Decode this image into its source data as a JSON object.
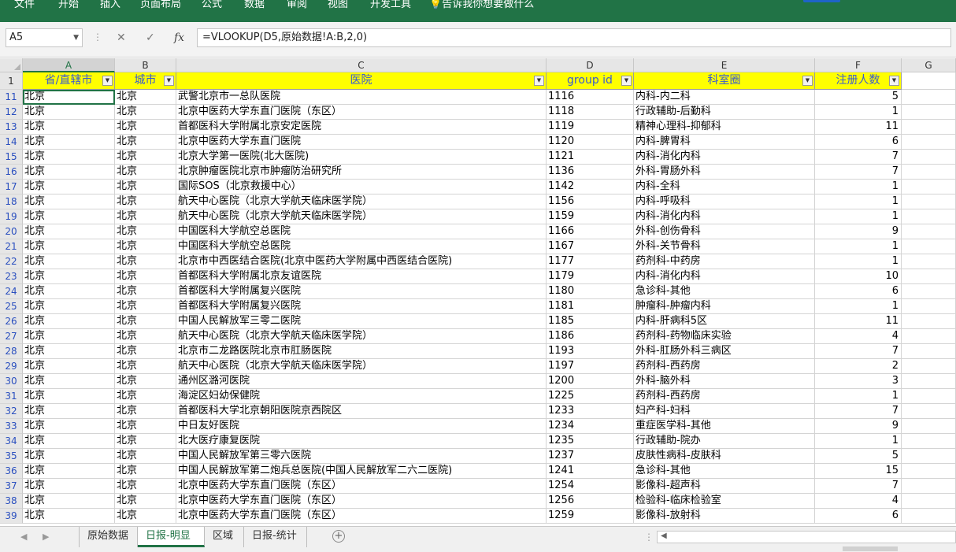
{
  "ribbon": {
    "tabs": [
      "文件",
      "开始",
      "插入",
      "页面布局",
      "公式",
      "数据",
      "审阅",
      "视图",
      "开发工具"
    ],
    "tell_me": "告诉我你想要做什么"
  },
  "formula_bar": {
    "name_box": "A5",
    "formula": "=VLOOKUP(D5,原始数据!A:B,2,0)"
  },
  "columns": [
    "A",
    "B",
    "C",
    "D",
    "E",
    "F",
    "G"
  ],
  "header_row": {
    "row_number": "1",
    "cells": [
      "省/直辖市",
      "城市",
      "医院",
      "group id",
      "科室圈",
      "注册人数"
    ]
  },
  "rows": [
    {
      "n": "11",
      "a": "北京",
      "b": "北京",
      "c": "武警北京市一总队医院",
      "d": "1116",
      "e": "内科-内二科",
      "f": "5"
    },
    {
      "n": "12",
      "a": "北京",
      "b": "北京",
      "c": "北京中医药大学东直门医院（东区）",
      "d": "1118",
      "e": "行政辅助-后勤科",
      "f": "1"
    },
    {
      "n": "13",
      "a": "北京",
      "b": "北京",
      "c": "首都医科大学附属北京安定医院",
      "d": "1119",
      "e": "精神心理科-抑郁科",
      "f": "11"
    },
    {
      "n": "14",
      "a": "北京",
      "b": "北京",
      "c": "北京中医药大学东直门医院",
      "d": "1120",
      "e": "内科-脾胃科",
      "f": "6"
    },
    {
      "n": "15",
      "a": "北京",
      "b": "北京",
      "c": "北京大学第一医院(北大医院)",
      "d": "1121",
      "e": "内科-消化内科",
      "f": "7"
    },
    {
      "n": "16",
      "a": "北京",
      "b": "北京",
      "c": "北京肿瘤医院北京市肿瘤防治研究所",
      "d": "1136",
      "e": "外科-胃肠外科",
      "f": "7"
    },
    {
      "n": "17",
      "a": "北京",
      "b": "北京",
      "c": "国际SOS（北京救援中心）",
      "d": "1142",
      "e": "内科-全科",
      "f": "1"
    },
    {
      "n": "18",
      "a": "北京",
      "b": "北京",
      "c": "航天中心医院（北京大学航天临床医学院）",
      "d": "1156",
      "e": "内科-呼吸科",
      "f": "1"
    },
    {
      "n": "19",
      "a": "北京",
      "b": "北京",
      "c": "航天中心医院（北京大学航天临床医学院）",
      "d": "1159",
      "e": "内科-消化内科",
      "f": "1"
    },
    {
      "n": "20",
      "a": "北京",
      "b": "北京",
      "c": "中国医科大学航空总医院",
      "d": "1166",
      "e": "外科-创伤骨科",
      "f": "9"
    },
    {
      "n": "21",
      "a": "北京",
      "b": "北京",
      "c": "中国医科大学航空总医院",
      "d": "1167",
      "e": "外科-关节骨科",
      "f": "1"
    },
    {
      "n": "22",
      "a": "北京",
      "b": "北京",
      "c": "北京市中西医结合医院(北京中医药大学附属中西医结合医院)",
      "d": "1177",
      "e": "药剂科-中药房",
      "f": "1"
    },
    {
      "n": "23",
      "a": "北京",
      "b": "北京",
      "c": "首都医科大学附属北京友谊医院",
      "d": "1179",
      "e": "内科-消化内科",
      "f": "10"
    },
    {
      "n": "24",
      "a": "北京",
      "b": "北京",
      "c": "首都医科大学附属复兴医院",
      "d": "1180",
      "e": "急诊科-其他",
      "f": "6"
    },
    {
      "n": "25",
      "a": "北京",
      "b": "北京",
      "c": "首都医科大学附属复兴医院",
      "d": "1181",
      "e": "肿瘤科-肿瘤内科",
      "f": "1"
    },
    {
      "n": "26",
      "a": "北京",
      "b": "北京",
      "c": "中国人民解放军三零二医院",
      "d": "1185",
      "e": "内科-肝病科5区",
      "f": "11"
    },
    {
      "n": "27",
      "a": "北京",
      "b": "北京",
      "c": "航天中心医院（北京大学航天临床医学院）",
      "d": "1186",
      "e": "药剂科-药物临床实验",
      "f": "4"
    },
    {
      "n": "28",
      "a": "北京",
      "b": "北京",
      "c": "北京市二龙路医院北京市肛肠医院",
      "d": "1193",
      "e": "外科-肛肠外科三病区",
      "f": "7"
    },
    {
      "n": "29",
      "a": "北京",
      "b": "北京",
      "c": "航天中心医院（北京大学航天临床医学院）",
      "d": "1197",
      "e": "药剂科-西药房",
      "f": "2"
    },
    {
      "n": "30",
      "a": "北京",
      "b": "北京",
      "c": "通州区潞河医院",
      "d": "1200",
      "e": "外科-脑外科",
      "f": "3"
    },
    {
      "n": "31",
      "a": "北京",
      "b": "北京",
      "c": "海淀区妇幼保健院",
      "d": "1225",
      "e": "药剂科-西药房",
      "f": "1"
    },
    {
      "n": "32",
      "a": "北京",
      "b": "北京",
      "c": "首都医科大学北京朝阳医院京西院区",
      "d": "1233",
      "e": "妇产科-妇科",
      "f": "7"
    },
    {
      "n": "33",
      "a": "北京",
      "b": "北京",
      "c": "中日友好医院",
      "d": "1234",
      "e": "重症医学科-其他",
      "f": "9"
    },
    {
      "n": "34",
      "a": "北京",
      "b": "北京",
      "c": "北大医疗康复医院",
      "d": "1235",
      "e": "行政辅助-院办",
      "f": "1"
    },
    {
      "n": "35",
      "a": "北京",
      "b": "北京",
      "c": "中国人民解放军第三零六医院",
      "d": "1237",
      "e": "皮肤性病科-皮肤科",
      "f": "5"
    },
    {
      "n": "36",
      "a": "北京",
      "b": "北京",
      "c": "中国人民解放军第二炮兵总医院(中国人民解放军二六二医院)",
      "d": "1241",
      "e": "急诊科-其他",
      "f": "15"
    },
    {
      "n": "37",
      "a": "北京",
      "b": "北京",
      "c": "北京中医药大学东直门医院（东区）",
      "d": "1254",
      "e": "影像科-超声科",
      "f": "7"
    },
    {
      "n": "38",
      "a": "北京",
      "b": "北京",
      "c": "北京中医药大学东直门医院（东区）",
      "d": "1256",
      "e": "检验科-临床检验室",
      "f": "4"
    },
    {
      "n": "39",
      "a": "北京",
      "b": "北京",
      "c": "北京中医药大学东直门医院（东区）",
      "d": "1259",
      "e": "影像科-放射科",
      "f": "6"
    }
  ],
  "sheet_tabs": [
    "原始数据",
    "日报-明显",
    "区域",
    "日报-统计"
  ],
  "active_sheet": "日报-明显",
  "colors": {
    "accent": "#217346",
    "header_fill": "#ffff00",
    "header_text": "#3a5bd0"
  }
}
